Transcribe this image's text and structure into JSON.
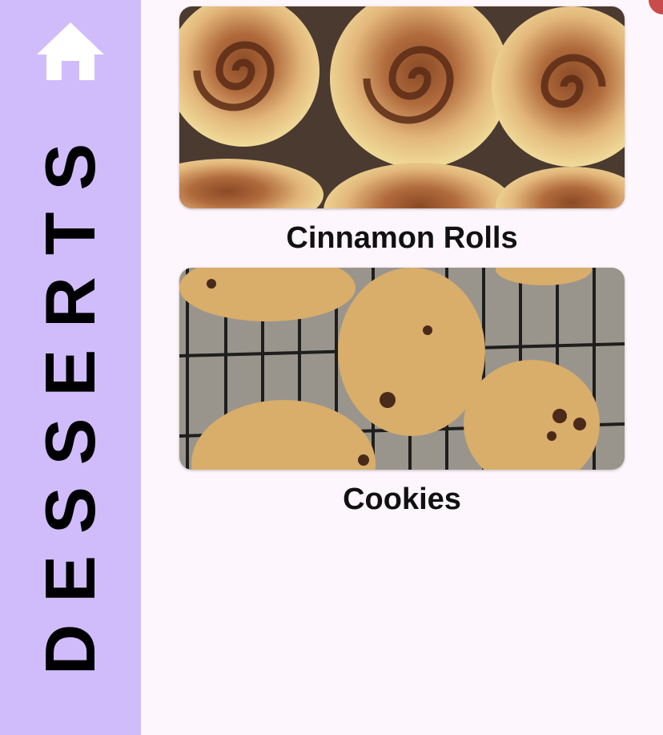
{
  "sidebar": {
    "title": "DESSERTS",
    "home_icon": "home-icon",
    "background": "#d0bcfb"
  },
  "content": {
    "background": "#fdf6fc",
    "items": [
      {
        "label": "Cinnamon Rolls",
        "image": "cinnamon-rolls-photo"
      },
      {
        "label": "Cookies",
        "image": "cookies-photo"
      }
    ]
  },
  "accent": "#c94b4b"
}
